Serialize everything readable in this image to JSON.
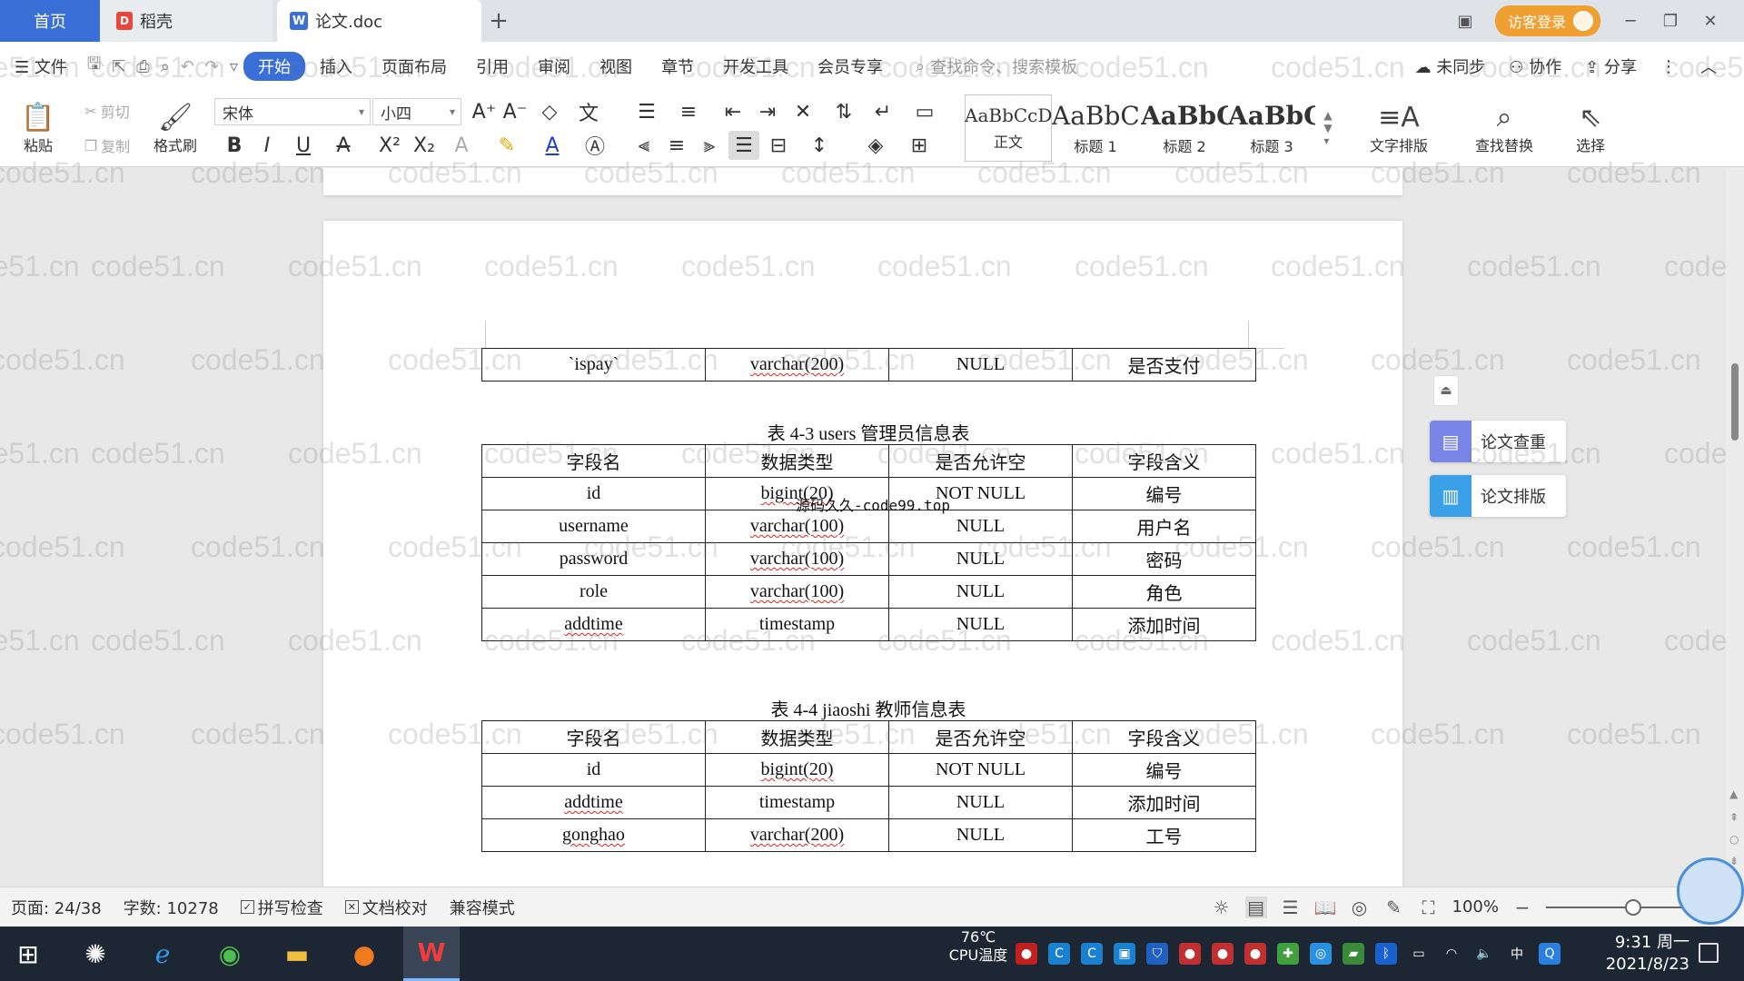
{
  "tabs": [
    {
      "label": "首页"
    },
    {
      "label": "稻壳"
    },
    {
      "label": "论文.doc"
    }
  ],
  "tab_bar_right": {
    "guest_login": "访客登录"
  },
  "menu": {
    "file": "文件",
    "items": [
      "开始",
      "插入",
      "页面布局",
      "引用",
      "审阅",
      "视图",
      "章节",
      "开发工具",
      "会员专享"
    ],
    "search_placeholder": "查找命令、搜索模板",
    "right": {
      "sync": "未同步",
      "collab": "协作",
      "share": "分享"
    }
  },
  "ribbon": {
    "paste": "粘贴",
    "cut": "剪切",
    "copy": "复制",
    "format_painter": "格式刷",
    "font_name": "宋体",
    "font_size": "小四",
    "styles": [
      {
        "sample": "AaBbCcDd",
        "name": "正文"
      },
      {
        "sample": "AaBbC",
        "name": "标题 1"
      },
      {
        "sample": "AaBbC",
        "name": "标题 2"
      },
      {
        "sample": "AaBbC",
        "name": "标题 3"
      }
    ],
    "text_layout": "文字排版",
    "find_replace": "查找替换",
    "select": "选择"
  },
  "side_panel": {
    "check": "论文查重",
    "layout": "论文排版"
  },
  "watermark_text": "code51.cn",
  "overlay_watermark": "源码久久-code99.top",
  "document": {
    "table_top_row": [
      "`ispay`",
      "varchar(200)",
      "NULL",
      "是否支付"
    ],
    "table3": {
      "caption": "表 4-3    users 管理员信息表",
      "header": [
        "字段名",
        "数据类型",
        "是否允许空",
        "字段含义"
      ],
      "rows": [
        [
          "id",
          "bigint(20)",
          "NOT NULL",
          "编号"
        ],
        [
          "username",
          "varchar(100)",
          "NULL",
          "用户名"
        ],
        [
          "password",
          "varchar(100)",
          "NULL",
          "密码"
        ],
        [
          "role",
          "varchar(100)",
          "NULL",
          "角色"
        ],
        [
          "addtime",
          "timestamp",
          "NULL",
          "添加时间"
        ]
      ]
    },
    "table4": {
      "caption": "表 4-4    jiaoshi 教师信息表",
      "header": [
        "字段名",
        "数据类型",
        "是否允许空",
        "字段含义"
      ],
      "rows": [
        [
          "id",
          "bigint(20)",
          "NOT NULL",
          "编号"
        ],
        [
          "addtime",
          "timestamp",
          "NULL",
          "添加时间"
        ],
        [
          "gonghao",
          "varchar(200)",
          "NULL",
          "工号"
        ]
      ]
    }
  },
  "status": {
    "page": "页面: 24/38",
    "words": "字数: 10278",
    "spell": "拼写检查",
    "proof": "文档校对",
    "compat": "兼容模式",
    "zoom": "100%",
    "zoom_fraction": 0.6
  },
  "taskbar": {
    "cpu_temp": "76℃",
    "cpu_label": "CPU温度",
    "time": "9:31 周一",
    "date": "2021/8/23"
  }
}
